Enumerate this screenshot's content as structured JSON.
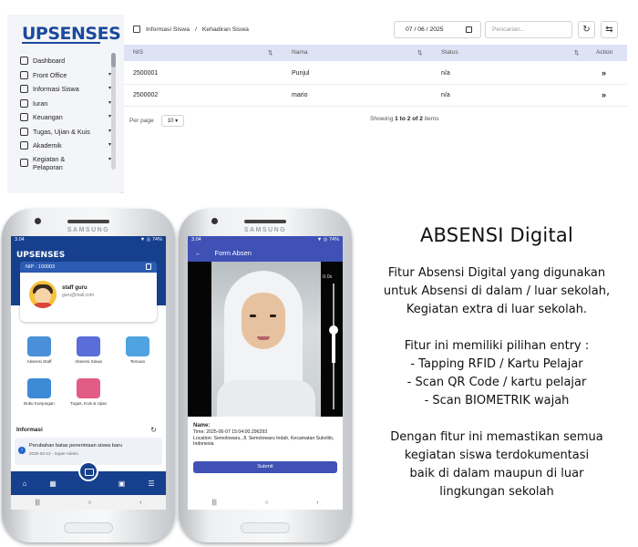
{
  "web": {
    "logo_up": "UP",
    "logo_rest": "SENSES",
    "sidebar": [
      {
        "label": "Dashboard",
        "icon": "home-icon",
        "chevron": false
      },
      {
        "label": "Front Office",
        "icon": "folder-icon",
        "chevron": true
      },
      {
        "label": "Informasi Siswa",
        "icon": "users-icon",
        "chevron": true
      },
      {
        "label": "Iuran",
        "icon": "money-icon",
        "chevron": true
      },
      {
        "label": "Keuangan",
        "icon": "wallet-icon",
        "chevron": true
      },
      {
        "label": "Tugas, Ujian & Kuis",
        "icon": "task-icon",
        "chevron": true
      },
      {
        "label": "Akademik",
        "icon": "academic-icon",
        "chevron": true
      },
      {
        "label": "Kegiatan &\nPelaporan",
        "icon": "report-icon",
        "chevron": true
      }
    ],
    "breadcrumb": [
      "Informasi Siswa",
      "Kehadiran Siswa"
    ],
    "breadcrumb_sep": "/",
    "date_value": "07 / 06 / 2025",
    "search_placeholder": "Pencarian...",
    "refresh_icon": "↻",
    "filter_icon": "⇆",
    "columns": [
      "NIS",
      "Nama",
      "Status",
      "Action"
    ],
    "sort_icon": "⇅",
    "rows": [
      {
        "nis": "2500001",
        "nama": "Punjul",
        "status": "n/a",
        "action": "»"
      },
      {
        "nis": "2500002",
        "nama": "mario",
        "status": "n/a",
        "action": "»"
      }
    ],
    "per_page_label": "Per page",
    "per_page_value": "10",
    "per_page_caret": "▾",
    "page_info_prefix": "Showing ",
    "page_info_range": "1 to 2 of 2",
    "page_info_suffix": " items"
  },
  "phone1": {
    "brand": "SAMSUNG",
    "time": "3.04",
    "status_icons": "▼ ◎ 74%",
    "logo": "UPSENSES",
    "nip": "NIP : 100003",
    "user_name": "staff guru",
    "user_email": "guru@mail.com",
    "menu": [
      {
        "label": "Absensi Staff",
        "color": "#4a90d9"
      },
      {
        "label": "Absensi Siswa",
        "color": "#5a6dd8"
      },
      {
        "label": "Temuan",
        "color": "#4ea3e0"
      },
      {
        "label": "Buku Kunjungan",
        "color": "#3d8bd6"
      },
      {
        "label": "Tugas, Kuis & Ujian",
        "color": "#e25c86"
      }
    ],
    "info_title": "Informasi",
    "notif_title": "Perubahan batas penerimaan siswa baru",
    "notif_meta": "2025-04-12 - Super Admin",
    "nav": [
      "⌂",
      "▦",
      "▣",
      "☰"
    ],
    "sysnav": [
      "|||",
      "○",
      "‹"
    ]
  },
  "phone2": {
    "brand": "SAMSUNG",
    "time": "3.04",
    "status_icons": "▼ ◎ 74%",
    "back_arrow": "←",
    "title": "Form Absen",
    "zoom": "0.0x",
    "name_label": "Name:",
    "time_line": "Time: 2025-06-07 15:04:00.296293",
    "location_line": "Location: Semolowaru, Jl. Semolowaru Indah, Kecamatan Sukolilo, Indonesia",
    "submit": "Submit",
    "sysnav": [
      "|||",
      "○",
      "‹"
    ]
  },
  "panel": {
    "title": "ABSENSI Digital",
    "intro": [
      "Fitur Absensi Digital yang digunakan",
      "untuk Absensi di dalam / luar sekolah,",
      "Kegiatan extra di luar sekolah."
    ],
    "options_title": "Fitur ini memiliki pilihan entry :",
    "options": [
      "- Tapping RFID / Kartu Pelajar",
      "- Scan QR Code / kartu pelajar",
      "- Scan BIOMETRIK wajah"
    ],
    "closing": [
      "Dengan fitur ini memastikan semua",
      "kegiatan siswa terdokumentasi",
      "baik di dalam maupun di luar",
      "lingkungan sekolah"
    ]
  }
}
